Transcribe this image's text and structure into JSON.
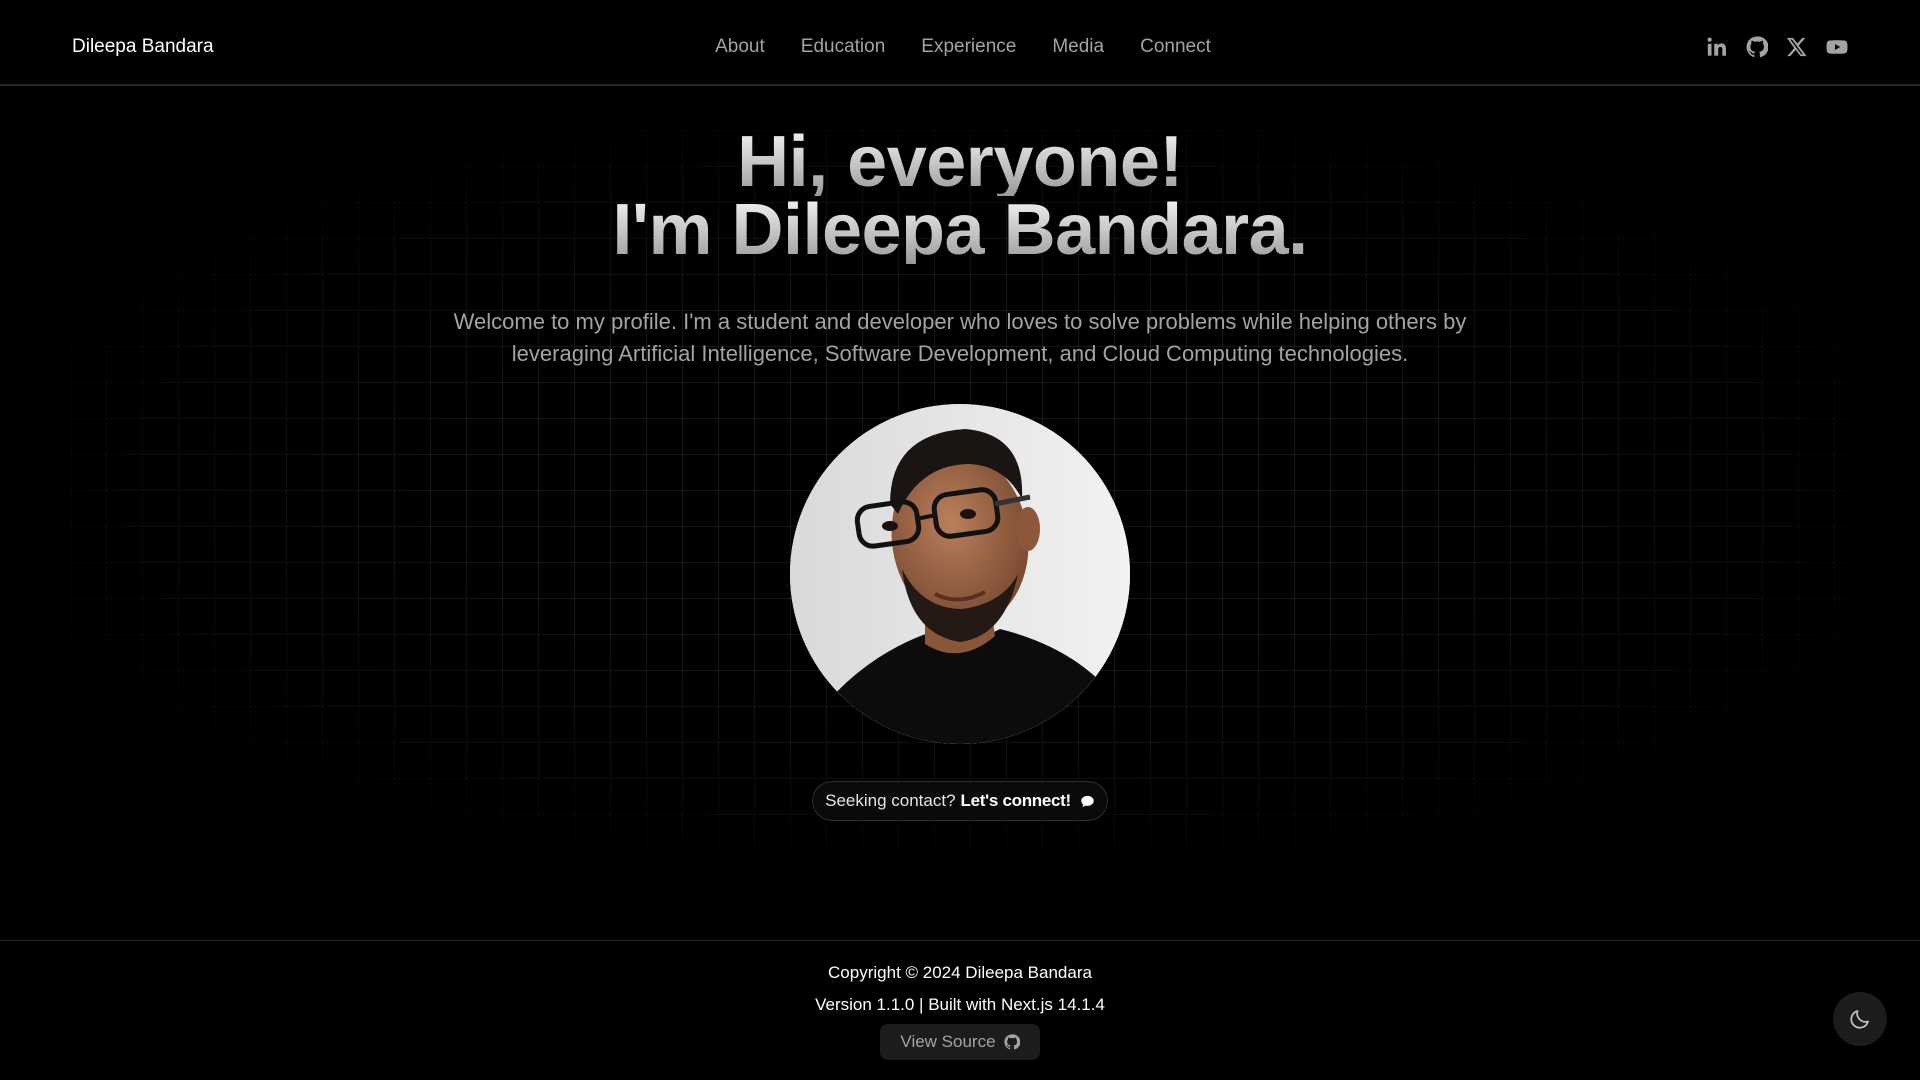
{
  "header": {
    "brand": "Dileepa Bandara",
    "nav": [
      "About",
      "Education",
      "Experience",
      "Media",
      "Connect"
    ],
    "social_icons": [
      "linkedin-icon",
      "github-icon",
      "x-icon",
      "youtube-icon"
    ]
  },
  "hero": {
    "line1": "Hi, everyone!",
    "line2": "I'm Dileepa Bandara.",
    "intro_line1": "Welcome to my profile. I'm a student and developer who loves to solve problems while helping others by",
    "intro_line2": "leveraging Artificial Intelligence, Software Development, and Cloud Computing technologies."
  },
  "cta": {
    "prefix": "Seeking contact?",
    "bold": "Let's connect!",
    "icon": "chat-bubble-icon"
  },
  "footer": {
    "copyright": "Copyright © 2024 Dileepa Bandara",
    "version": "Version 1.1.0 | Built with Next.js 14.1.4",
    "source_label": "View Source"
  },
  "theme_toggle_icon": "moon-icon",
  "colors": {
    "background": "#000000",
    "muted_text": "#a3a3a3",
    "border": "#262626"
  }
}
